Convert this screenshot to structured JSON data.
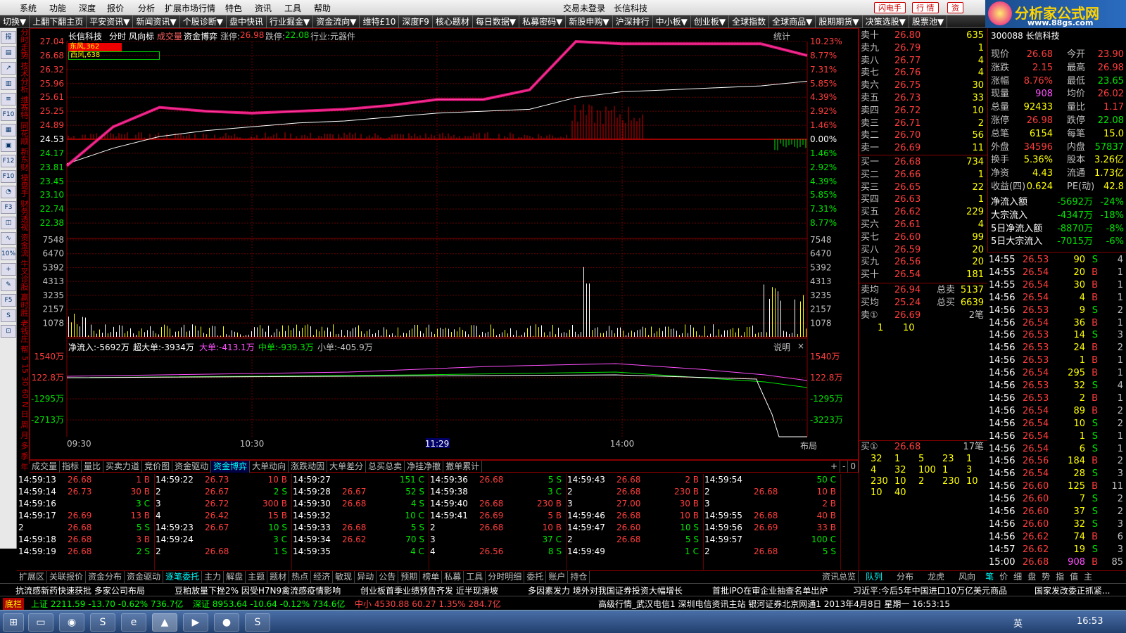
{
  "menu": [
    "系统",
    "功能",
    "深度",
    "报价",
    "分析",
    "扩展市场行情",
    "特色",
    "资讯",
    "工具",
    "帮助"
  ],
  "menu_center": [
    "交易未登录",
    "长信科技"
  ],
  "menu_buttons": [
    "闪电手",
    "行 情",
    "资"
  ],
  "logo": {
    "title": "分析家公式网",
    "url": "www.88gs.com"
  },
  "toolbar": [
    "切换▼",
    "上翻下翻主页",
    "平安资讯▼",
    "新闻资讯▼",
    "个股诊断▼",
    "盘中快讯",
    "行业掘金▼",
    "资金流向▼",
    "维特£10",
    "深度F9",
    "核心题材",
    "每日数据▼",
    "私募密码▼",
    "新股申购▼",
    "沪深排行",
    "中小板▼",
    "创业板▼",
    "全球指数",
    "全球商品▼",
    "股期期货▼",
    "决策选股▼",
    "股票池▼"
  ],
  "vtabs": [
    "分时走势",
    "技术分析",
    "维赛特",
    "同花顺",
    "新东财",
    "操盘手",
    "财务透视",
    "资金流",
    "牛叉诊股",
    "赢时胜",
    "老钱庄",
    "帮",
    "5",
    "15",
    "30",
    "60",
    "N",
    "日",
    "周",
    "月",
    "多",
    "季",
    "年"
  ],
  "chart": {
    "header": {
      "name": "长信科技",
      "tabs": [
        "分时",
        "风向标",
        "成交量",
        "资金博弈"
      ],
      "limit_up_label": "涨停:",
      "limit_up": "26.98",
      "limit_down_label": "跌停:",
      "limit_down": "22.08",
      "industry": "行业:元器件",
      "stat": "统计"
    },
    "wind": [
      {
        "label": "东风",
        "value": "362"
      },
      {
        "label": "西风",
        "value": "638"
      }
    ],
    "price_left": [
      "27.04",
      "26.68",
      "26.32",
      "25.96",
      "25.61",
      "25.25",
      "24.89",
      "24.53",
      "24.17",
      "23.81",
      "23.45",
      "23.10",
      "22.74",
      "22.38"
    ],
    "price_right": [
      "10.23%",
      "8.77%",
      "7.31%",
      "5.85%",
      "4.39%",
      "2.92%",
      "1.46%",
      "0.00%",
      "1.46%",
      "2.92%",
      "4.39%",
      "5.85%",
      "7.31%",
      "8.77%"
    ],
    "vol_labels": [
      "7548",
      "6470",
      "5392",
      "4313",
      "3235",
      "2157",
      "1078"
    ],
    "flow": {
      "net": "净流入:-5692万",
      "super": "超大单:-3934万",
      "big": "大单:-413.1万",
      "mid": "中单:-939.3万",
      "small": "小单:-405.9万",
      "explain": "说明"
    },
    "flow_left": [
      "1540万",
      "122.8万",
      "-1295万",
      "-2713万"
    ],
    "flow_right": [
      "1540万",
      "122.8万",
      "-1295万",
      "-3223万"
    ],
    "time_labels": [
      "09:30",
      "10:30",
      "11:29",
      "14:00"
    ],
    "layout_btn": "布局"
  },
  "chart_data": {
    "type": "line",
    "title": "长信科技",
    "x": [
      "09:30",
      "09:45",
      "10:00",
      "10:15",
      "10:30",
      "10:45",
      "11:00",
      "11:15",
      "11:30",
      "13:15",
      "13:30",
      "13:45",
      "14:00",
      "14:15",
      "14:30",
      "14:45",
      "15:00"
    ],
    "series": [
      {
        "name": "price",
        "values": [
          23.85,
          24.85,
          25.35,
          25.25,
          25.2,
          25.25,
          25.3,
          25.4,
          25.55,
          25.55,
          25.8,
          27.04,
          26.98,
          26.98,
          26.98,
          26.98,
          26.68
        ]
      },
      {
        "name": "avg",
        "values": [
          23.9,
          24.3,
          24.6,
          24.75,
          24.85,
          24.95,
          25.0,
          25.1,
          25.2,
          25.25,
          25.3,
          25.6,
          25.75,
          25.8,
          25.85,
          25.9,
          26.02
        ]
      }
    ],
    "ylim": [
      22.02,
      27.04
    ],
    "reference": 24.53
  },
  "tabs2": [
    "成交量",
    "指标",
    "量比",
    "买卖力道",
    "竞价图",
    "资金驱动",
    "资金博弈",
    "大单动向",
    "涨跌动因",
    "大单差分",
    "总买总卖",
    "净挂净撤",
    "撤单累计"
  ],
  "tabs2_active": 6,
  "tabs2_controls": [
    "+",
    "-",
    "0"
  ],
  "trades": [
    [
      [
        "14:59:13",
        "26.68",
        "1 B",
        "r"
      ],
      [
        "14:59:14",
        "26.73",
        "30 B",
        "r"
      ],
      [
        "14:59:16",
        "",
        "3 C",
        "g"
      ],
      [
        "14:59:17",
        "26.69",
        "13 B",
        "r"
      ],
      [
        "2",
        "26.68",
        "5 S",
        "g"
      ],
      [
        "14:59:18",
        "26.68",
        "3 B",
        "r"
      ],
      [
        "14:59:19",
        "26.68",
        "2 S",
        "g"
      ]
    ],
    [
      [
        "14:59:22",
        "26.73",
        "10 B",
        "r"
      ],
      [
        "2",
        "26.67",
        "2 S",
        "g"
      ],
      [
        "3",
        "26.72",
        "300 B",
        "r"
      ],
      [
        "4",
        "26.42",
        "15 B",
        "r"
      ],
      [
        "14:59:23",
        "26.67",
        "10 S",
        "g"
      ],
      [
        "14:59:24",
        "",
        "3 C",
        "g"
      ],
      [
        "2",
        "26.68",
        "1 S",
        "g"
      ]
    ],
    [
      [
        "14:59:27",
        "",
        "151 C",
        "g"
      ],
      [
        "14:59:28",
        "26.67",
        "52 S",
        "g"
      ],
      [
        "14:59:30",
        "26.68",
        "4 S",
        "g"
      ],
      [
        "14:59:32",
        "",
        "10 C",
        "g"
      ],
      [
        "14:59:33",
        "26.68",
        "5 S",
        "g"
      ],
      [
        "14:59:34",
        "26.62",
        "70 S",
        "g"
      ],
      [
        "14:59:35",
        "",
        "4 C",
        "g"
      ]
    ],
    [
      [
        "14:59:36",
        "26.68",
        "5 S",
        "g"
      ],
      [
        "14:59:38",
        "",
        "3 C",
        "g"
      ],
      [
        "14:59:40",
        "26.68",
        "230 B",
        "r"
      ],
      [
        "14:59:41",
        "26.69",
        "5 B",
        "r"
      ],
      [
        "2",
        "26.68",
        "10 B",
        "r"
      ],
      [
        "3",
        "",
        "37 C",
        "g"
      ],
      [
        "4",
        "26.56",
        "8 S",
        "g"
      ]
    ],
    [
      [
        "14:59:43",
        "26.68",
        "2 B",
        "r"
      ],
      [
        "2",
        "26.68",
        "230 B",
        "r"
      ],
      [
        "3",
        "27.00",
        "30 B",
        "r"
      ],
      [
        "14:59:46",
        "26.68",
        "10 B",
        "r"
      ],
      [
        "14:59:47",
        "26.60",
        "10 S",
        "g"
      ],
      [
        "2",
        "26.68",
        "5 S",
        "g"
      ],
      [
        "14:59:49",
        "",
        "1 C",
        "g"
      ]
    ],
    [
      [
        "14:59:54",
        "",
        "50 C",
        "g"
      ],
      [
        "2",
        "26.68",
        "10 B",
        "r"
      ],
      [
        "3",
        "",
        "2 B",
        "r"
      ],
      [
        "14:59:55",
        "26.68",
        "40 B",
        "r"
      ],
      [
        "14:59:56",
        "26.69",
        "33 B",
        "r"
      ],
      [
        "14:59:57",
        "",
        "100 C",
        "g"
      ],
      [
        "2",
        "26.68",
        "5 S",
        "g"
      ]
    ]
  ],
  "btabs": [
    "扩展区",
    "关联报价",
    "资金分布",
    "资金驱动",
    "逐笔委托",
    "主力",
    "解盘",
    "主题",
    "题材",
    "热点",
    "经济",
    "敏现",
    "异动",
    "公告",
    "预期",
    "榜单",
    "私募",
    "工具",
    "分时明细",
    "委托",
    "账户",
    "持仓"
  ],
  "btabs_right": "资讯总览",
  "book": {
    "sell": [
      [
        "卖十",
        "26.80",
        "635"
      ],
      [
        "卖九",
        "26.79",
        "1"
      ],
      [
        "卖八",
        "26.77",
        "4"
      ],
      [
        "卖七",
        "26.76",
        "4"
      ],
      [
        "卖六",
        "26.75",
        "30"
      ],
      [
        "卖五",
        "26.73",
        "33"
      ],
      [
        "卖四",
        "26.72",
        "10"
      ],
      [
        "卖三",
        "26.71",
        "2"
      ],
      [
        "卖二",
        "26.70",
        "56"
      ],
      [
        "卖一",
        "26.69",
        "11"
      ]
    ],
    "buy": [
      [
        "买一",
        "26.68",
        "734"
      ],
      [
        "买二",
        "26.66",
        "1"
      ],
      [
        "买三",
        "26.65",
        "22"
      ],
      [
        "买四",
        "26.63",
        "1"
      ],
      [
        "买五",
        "26.62",
        "229"
      ],
      [
        "买六",
        "26.61",
        "4"
      ],
      [
        "买七",
        "26.60",
        "99"
      ],
      [
        "买八",
        "26.59",
        "20"
      ],
      [
        "买九",
        "26.56",
        "20"
      ],
      [
        "买十",
        "26.54",
        "181"
      ]
    ],
    "avg_sell": [
      "卖均",
      "26.94",
      "总卖",
      "5137"
    ],
    "avg_buy": [
      "买均",
      "25.24",
      "总买",
      "6639"
    ],
    "sell0": [
      "卖①",
      "26.69",
      "2笔"
    ],
    "sell0_q": [
      "1",
      "10"
    ],
    "buy0": [
      "买①",
      "26.68",
      "17笔"
    ],
    "buy0_q": [
      [
        "32",
        "1",
        "5",
        "23",
        "1"
      ],
      [
        "4",
        "32",
        "100",
        "1",
        "3"
      ],
      [
        "230",
        "10",
        "2",
        "230",
        "10"
      ],
      [
        "10",
        "40"
      ]
    ]
  },
  "quote": {
    "rows": [
      [
        [
          "现价",
          "gray"
        ],
        [
          "26.68",
          "red"
        ],
        [
          "今开",
          "gray"
        ],
        [
          "23.90",
          "red"
        ]
      ],
      [
        [
          "涨跌",
          "gray"
        ],
        [
          "2.15",
          "red"
        ],
        [
          "最高",
          "gray"
        ],
        [
          "26.98",
          "red"
        ]
      ],
      [
        [
          "涨幅",
          "gray"
        ],
        [
          "8.76%",
          "red"
        ],
        [
          "最低",
          "gray"
        ],
        [
          "23.65",
          "green"
        ]
      ],
      [
        [
          "现量",
          "gray"
        ],
        [
          "908",
          "mag"
        ],
        [
          "均价",
          "gray"
        ],
        [
          "26.02",
          "red"
        ]
      ],
      [
        [
          "总量",
          "gray"
        ],
        [
          "92433",
          "yellow"
        ],
        [
          "量比",
          "gray"
        ],
        [
          "1.17",
          "red"
        ]
      ],
      [
        [
          "涨停",
          "gray"
        ],
        [
          "26.98",
          "red"
        ],
        [
          "跌停",
          "gray"
        ],
        [
          "22.08",
          "green"
        ]
      ],
      [
        [
          "总笔",
          "gray"
        ],
        [
          "6154",
          "yellow"
        ],
        [
          "每笔",
          "gray"
        ],
        [
          "15.0",
          "yellow"
        ]
      ],
      [
        [
          "外盘",
          "gray"
        ],
        [
          "34596",
          "red"
        ],
        [
          "内盘",
          "gray"
        ],
        [
          "57837",
          "green"
        ]
      ],
      [
        [
          "换手",
          "gray"
        ],
        [
          "5.36%",
          "yellow"
        ],
        [
          "股本",
          "gray"
        ],
        [
          "3.26亿",
          "yellow"
        ]
      ],
      [
        [
          "净资",
          "gray"
        ],
        [
          "4.43",
          "yellow"
        ],
        [
          "流通",
          "gray"
        ],
        [
          "1.73亿",
          "yellow"
        ]
      ],
      [
        [
          "收益(四)",
          "gray"
        ],
        [
          "0.624",
          "yellow"
        ],
        [
          "PE(动)",
          "gray"
        ],
        [
          "42.8",
          "yellow"
        ]
      ]
    ],
    "flows": [
      [
        "净流入额",
        "-5692万",
        "-24%"
      ],
      [
        "大宗流入",
        "-4347万",
        "-18%"
      ],
      [
        "5日净流入额",
        "-8870万",
        "-8%"
      ],
      [
        "5日大宗流入",
        "-7015万",
        "-6%"
      ]
    ],
    "code": "300088 长信科技"
  },
  "ticks": [
    [
      "14:55",
      "26.53",
      "90",
      "S",
      "4"
    ],
    [
      "14:55",
      "26.54",
      "20",
      "B",
      "1"
    ],
    [
      "14:55",
      "26.54",
      "30",
      "B",
      "1"
    ],
    [
      "14:56",
      "26.54",
      "4",
      "B",
      "1"
    ],
    [
      "14:56",
      "26.53",
      "9",
      "S",
      "2"
    ],
    [
      "14:56",
      "26.54",
      "36",
      "B",
      "1"
    ],
    [
      "14:56",
      "26.53",
      "14",
      "S",
      "3"
    ],
    [
      "14:56",
      "26.53",
      "24",
      "B",
      "2"
    ],
    [
      "14:56",
      "26.53",
      "1",
      "B",
      "1"
    ],
    [
      "14:56",
      "26.54",
      "295",
      "B",
      "1"
    ],
    [
      "14:56",
      "26.53",
      "32",
      "S",
      "4"
    ],
    [
      "14:56",
      "26.53",
      "2",
      "B",
      "1"
    ],
    [
      "14:56",
      "26.54",
      "89",
      "B",
      "2"
    ],
    [
      "14:56",
      "26.54",
      "10",
      "S",
      "2"
    ],
    [
      "14:56",
      "26.54",
      "1",
      "S",
      "1"
    ],
    [
      "14:56",
      "26.54",
      "6",
      "S",
      "1"
    ],
    [
      "14:56",
      "26.56",
      "184",
      "B",
      "2"
    ],
    [
      "14:56",
      "26.54",
      "28",
      "S",
      "3"
    ],
    [
      "14:56",
      "26.60",
      "125",
      "B",
      "11"
    ],
    [
      "14:56",
      "26.60",
      "7",
      "S",
      "2"
    ],
    [
      "14:56",
      "26.60",
      "37",
      "S",
      "2"
    ],
    [
      "14:56",
      "26.60",
      "32",
      "S",
      "3"
    ],
    [
      "14:56",
      "26.62",
      "74",
      "B",
      "6"
    ],
    [
      "14:57",
      "26.62",
      "19",
      "S",
      "3"
    ],
    [
      "15:00",
      "26.68",
      "908",
      "B",
      "85"
    ]
  ],
  "rtabs": [
    "队列",
    "分布",
    "龙虎",
    "风向"
  ],
  "rtabs2": [
    "笔",
    "价",
    "细",
    "盘",
    "势",
    "指",
    "值",
    "主"
  ],
  "news": [
    "抗流感新药快速获批 多家公司布局",
    "豆粕放量下挫2% 因受H7N9禽流感疫情影响",
    "创业板首季业绩预告齐发 近半现滑坡",
    "多因素发力 境外对我国证券投资大幅增长",
    "首批IPO在审企业抽查名单出炉",
    "习近平:今后5年中国进口10万亿美元商品",
    "国家发改委正抓紧..."
  ],
  "status": {
    "label": "底栏",
    "sh": "上证 2211.59 -13.70 -0.62% 736.7亿",
    "sz": "深证 8953.64 -10.64 -0.12% 734.6亿",
    "zx": "中小 4530.88 60.27 1.35% 284.7亿",
    "info": "高级行情_武汉电信1 深圳电信资讯主站 银河证券北京网通1 2013年4月8日 星期一 16:53:15"
  },
  "taskbar": {
    "time": "16:53",
    "ime": "英"
  },
  "colors": {
    "up": "#ff3c3c",
    "down": "#00e600",
    "axis": "#800000",
    "vol": "#ffff00",
    "avg": "#ffffff",
    "money": "#ff1a8c"
  }
}
